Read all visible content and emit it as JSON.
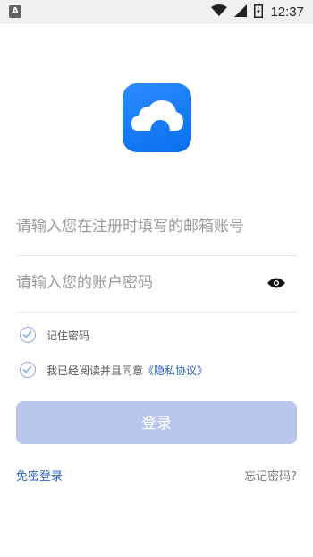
{
  "status_bar": {
    "time": "12:37",
    "notification_glyph": "A",
    "icons": [
      "wifi-icon",
      "signal-icon",
      "battery-charging-icon"
    ]
  },
  "logo": {
    "icon": "cloud-icon",
    "color": "#1a7cf5"
  },
  "form": {
    "email_placeholder": "请输入您在注册时填写的邮箱账号",
    "password_placeholder": "请输入您的账户密码",
    "password_toggle_icon": "eye-icon"
  },
  "options": {
    "remember_label": "记住密码",
    "agree_label": "我已经阅读并且同意",
    "privacy_link": "《隐私协议》"
  },
  "actions": {
    "login_label": "登录",
    "passwordless_login": "免密登录",
    "forgot_password": "忘记密码?"
  },
  "colors": {
    "accent": "#2b5fc4",
    "button_disabled": "#b8c6ee",
    "checkbox": "#8fa9e0"
  }
}
